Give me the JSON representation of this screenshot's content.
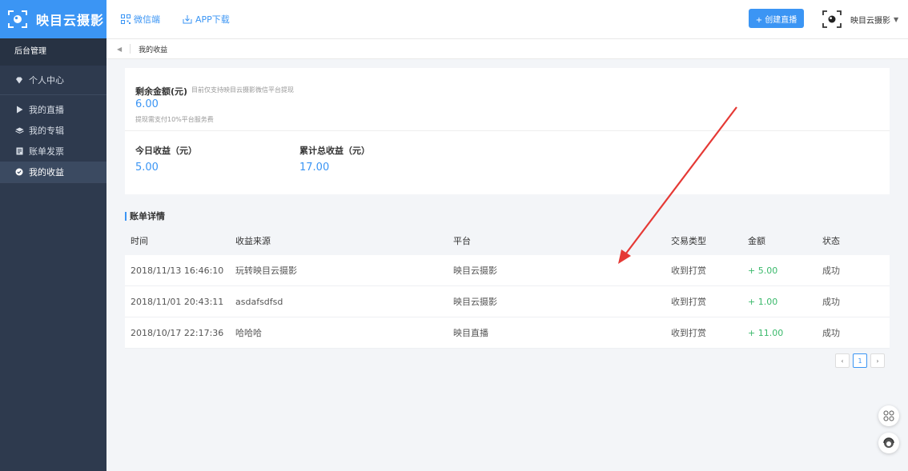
{
  "brand": {
    "name": "映目云摄影"
  },
  "topnav": {
    "wechat": "微信端",
    "app": "APP下载"
  },
  "header": {
    "create_label": "+ 创建直播",
    "user_name": "映目云摄影",
    "caret": "▼"
  },
  "sidebar": {
    "head": "后台管理",
    "items": [
      {
        "label": "个人中心",
        "icon": "diamond-icon"
      },
      {
        "label": "我的直播",
        "icon": "play-icon"
      },
      {
        "label": "我的专辑",
        "icon": "layers-icon"
      },
      {
        "label": "账单发票",
        "icon": "bill-icon"
      },
      {
        "label": "我的收益",
        "icon": "check-circle-icon",
        "active": true
      }
    ]
  },
  "breadcrumb": {
    "back": "◀",
    "current": "我的收益"
  },
  "balance": {
    "title": "剩余金额(元)",
    "note": "目前仅支持映目云摄影微信平台提现",
    "value": "6.00",
    "fee": "提现需支付10%平台服务费"
  },
  "stats": {
    "today_label": "今日收益（元）",
    "today_value": "5.00",
    "total_label": "累计总收益（元）",
    "total_value": "17.00"
  },
  "details": {
    "title": "账单详情",
    "columns": [
      "时间",
      "收益来源",
      "平台",
      "交易类型",
      "金额",
      "状态"
    ],
    "rows": [
      [
        "2018/11/13 16:46:10",
        "玩转映目云摄影",
        "映目云摄影",
        "收到打赏",
        "+ 5.00",
        "成功"
      ],
      [
        "2018/11/01 20:43:11",
        "asdafsdfsd",
        "映目云摄影",
        "收到打赏",
        "+ 1.00",
        "成功"
      ],
      [
        "2018/10/17 22:17:36",
        "哈哈哈",
        "映目直播",
        "收到打赏",
        "+ 11.00",
        "成功"
      ]
    ]
  },
  "pager": {
    "prev": "‹",
    "page": "1",
    "next": "›"
  },
  "colors": {
    "accent": "#3b95f4",
    "sidebar": "#2e3a4e",
    "amount": "#3ab96b"
  }
}
